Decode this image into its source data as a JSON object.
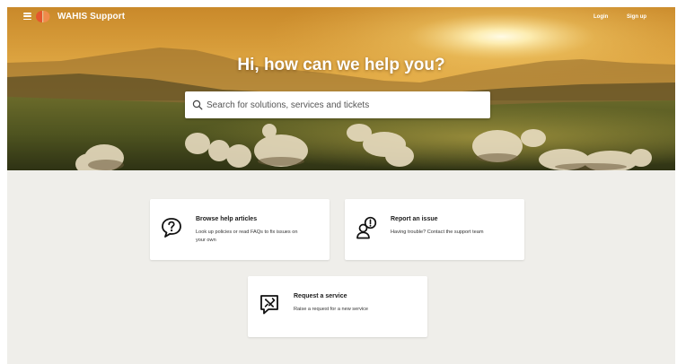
{
  "header": {
    "brand": "WAHIS Support",
    "login_label": "Login",
    "signup_label": "Sign up"
  },
  "hero": {
    "headline": "Hi, how can we help you?",
    "search_placeholder": "Search for solutions, services and tickets"
  },
  "cards": [
    {
      "title": "Browse help articles",
      "description": "Look up policies or read FAQs to fix issues on your own",
      "icon": "chat-question-icon"
    },
    {
      "title": "Report an issue",
      "description": "Having trouble? Contact the support team",
      "icon": "user-alert-icon"
    },
    {
      "title": "Request a service",
      "description": "Raise a request for a new service",
      "icon": "tools-request-icon"
    }
  ],
  "colors": {
    "logo_orange": "#e4572e",
    "page_background": "#efeeea",
    "card_background": "#ffffff"
  }
}
